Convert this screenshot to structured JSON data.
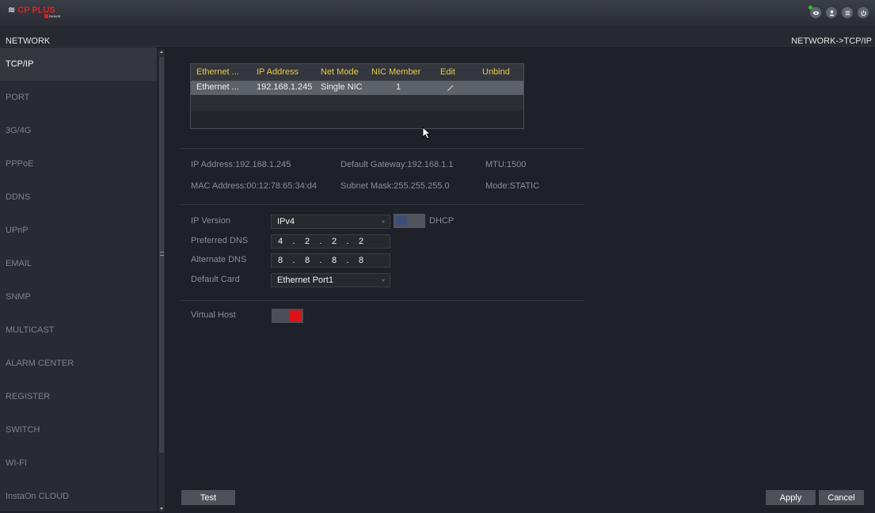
{
  "brand": {
    "logo": "CP PLUS",
    "logo_mark": "≋",
    "sub": "RANGE"
  },
  "header": {
    "section": "NETWORK",
    "breadcrumb": "NETWORK->TCP/IP"
  },
  "top_icons": [
    "eye-icon",
    "user-icon",
    "menu-icon",
    "power-icon"
  ],
  "sidebar": {
    "items": [
      {
        "label": "TCP/IP",
        "active": true
      },
      {
        "label": "PORT"
      },
      {
        "label": "3G/4G"
      },
      {
        "label": "PPPoE"
      },
      {
        "label": "DDNS"
      },
      {
        "label": "UPnP"
      },
      {
        "label": "EMAIL"
      },
      {
        "label": "SNMP"
      },
      {
        "label": "MULTICAST"
      },
      {
        "label": "ALARM CENTER"
      },
      {
        "label": "REGISTER"
      },
      {
        "label": "SWITCH"
      },
      {
        "label": "WI-FI"
      },
      {
        "label": "InstaOn CLOUD"
      }
    ]
  },
  "nic_table": {
    "columns": [
      "Ethernet ...",
      "IP Address",
      "Net Mode",
      "NIC Member",
      "Edit",
      "Unbind"
    ],
    "rows": [
      {
        "ethernet": "Ethernet ...",
        "ip": "192.168.1.245",
        "mode": "Single NIC",
        "member": "1"
      }
    ]
  },
  "info": {
    "ip": "IP Address:192.168.1.245",
    "gateway": "Default Gateway:192.168.1.1",
    "mtu": "MTU:1500",
    "mac": "MAC Address:00:12:78:65:34:d4",
    "subnet": "Subnet Mask:255.255.255.0",
    "mode": "Mode:STATIC"
  },
  "form": {
    "ip_version_label": "IP Version",
    "ip_version_value": "IPv4",
    "dhcp_label": "DHCP",
    "dhcp_enabled": false,
    "preferred_dns_label": "Preferred DNS",
    "preferred_dns": [
      "4",
      "2",
      "2",
      "2"
    ],
    "alternate_dns_label": "Alternate DNS",
    "alternate_dns": [
      "8",
      "8",
      "8",
      "8"
    ],
    "ip_dot": ".",
    "default_card_label": "Default Card",
    "default_card_value": "Ethernet Port1",
    "virtual_host_label": "Virtual Host",
    "virtual_host_enabled": true
  },
  "buttons": {
    "test": "Test",
    "apply": "Apply",
    "cancel": "Cancel"
  },
  "colors": {
    "accent_yellow": "#e8c84c",
    "toggle_on": "#e0101a",
    "toggle_off_knob": "#3c4d78",
    "brand_red": "#dd2222"
  }
}
